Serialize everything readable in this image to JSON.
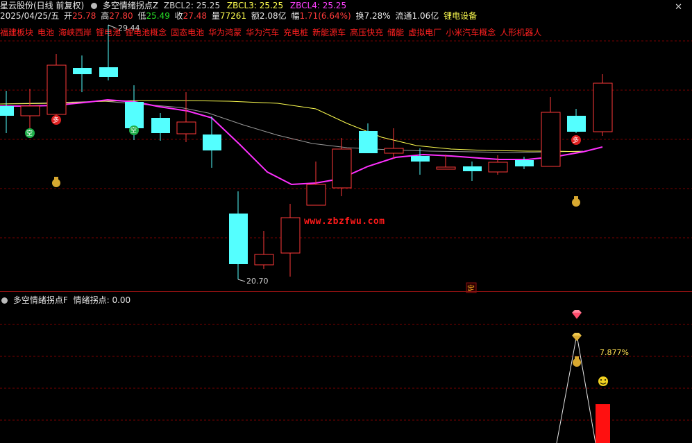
{
  "header": {
    "stock_title": "星云股份(日线 前复权)",
    "indicator_name": "多空情绪拐点Z",
    "zbcl2_label": "ZBCL2:",
    "zbcl2_value": "25.25",
    "zbcl3_label": "ZBCL3:",
    "zbcl3_value": "25.25",
    "zbcl4_label": "ZBCL4:",
    "zbcl4_value": "25.25"
  },
  "quote": {
    "date": "2025/04/25/五",
    "open_label": "开",
    "open": "25.78",
    "high_label": "高",
    "high": "27.80",
    "low_label": "低",
    "low": "25.49",
    "close_label": "收",
    "close": "27.48",
    "volume_label": "量",
    "volume": "77261",
    "amount_label": "额",
    "amount": "2.08亿",
    "change_label": "幅",
    "change": "1.71(6.64%)",
    "turnover_label": "换",
    "turnover": "7.28%",
    "float_label": "流通",
    "float": "1.06亿",
    "industry": "锂电设备"
  },
  "concepts": [
    "福建板块",
    "电池",
    "海峡西岸",
    "锂电池",
    "锂电池概念",
    "固态电池",
    "华为鸿蒙",
    "华为汽车",
    "充电桩",
    "新能源车",
    "高压快充",
    "储能",
    "虚拟电厂",
    "小米汽车概念",
    "人形机器人"
  ],
  "annotations": {
    "high_price": "29.44",
    "low_price": "20.70",
    "ding": "定",
    "percent": "7.877%",
    "watermark": "www.zbzfwu.com"
  },
  "indicator": {
    "title": "多空情绪拐点F",
    "value_label": "情绪拐点:",
    "value": "0.00"
  },
  "colors": {
    "up": "#ff3a3a",
    "down": "#54ffff",
    "ma_magenta": "#ff30ff",
    "ma_yellow": "#ffff50",
    "ma_gray": "#9a9a9a",
    "grid": "#7a0000"
  },
  "icons": {
    "kong_badge": "空",
    "duo_badge": "多",
    "money_bag": "money-bag-icon",
    "diamond": "diamond-icon",
    "smiley": "smiley-icon"
  }
}
